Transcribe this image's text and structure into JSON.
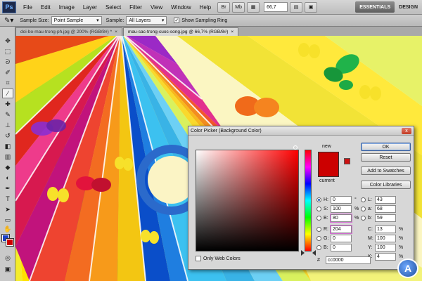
{
  "app": {
    "logo": "Ps",
    "menu": [
      "File",
      "Edit",
      "Image",
      "Layer",
      "Select",
      "Filter",
      "View",
      "Window",
      "Help"
    ],
    "zoom": "66,7",
    "workspace": {
      "active": "ESSENTIALS",
      "other": "DESIGN"
    }
  },
  "options": {
    "sample_size_label": "Sample Size:",
    "sample_size_value": "Point Sample",
    "sample_label": "Sample:",
    "sample_value": "All Layers",
    "show_ring_label": "Show Sampling Ring",
    "show_ring_checked": true
  },
  "tabs": [
    {
      "label": "doi-bo-mau-trong-ph.jpg @ 200% (RGB/8#) *",
      "active": false
    },
    {
      "label": "mau-sac-trong-cuoc-song.jpg @ 66,7% (RGB/8#)",
      "active": true
    }
  ],
  "toolbox": {
    "icons": [
      "move-icon",
      "marquee-icon",
      "lasso-icon",
      "quick-select-icon",
      "crop-icon",
      "eyedropper-icon",
      "healing-icon",
      "brush-icon",
      "stamp-icon",
      "history-brush-icon",
      "eraser-icon",
      "gradient-icon",
      "blur-icon",
      "dodge-icon",
      "pen-icon",
      "type-icon",
      "path-select-icon",
      "shape-icon",
      "hand-icon",
      "zoom-icon"
    ],
    "selected": "eyedropper-icon",
    "foreground_color": "#1d41c7",
    "background_color": "#cc0000"
  },
  "dialog": {
    "title": "Color Picker (Background Color)",
    "close": "x",
    "new_label": "new",
    "current_label": "current",
    "selected_color": "#cc0000",
    "buttons": {
      "ok": "OK",
      "reset": "Reset",
      "add_swatches": "Add to Swatches",
      "libraries": "Color Libraries"
    },
    "only_web_colors": "Only Web Colors",
    "hsb": [
      {
        "label": "H:",
        "value": "0",
        "unit": "°",
        "selected": true
      },
      {
        "label": "S:",
        "value": "100",
        "unit": "%",
        "selected": false
      },
      {
        "label": "B:",
        "value": "80",
        "unit": "%",
        "selected": false
      }
    ],
    "rgb": [
      {
        "label": "R:",
        "value": "204",
        "selected": false
      },
      {
        "label": "G:",
        "value": "0",
        "selected": false
      },
      {
        "label": "B:",
        "value": "0",
        "selected": false
      }
    ],
    "lab": [
      {
        "label": "L:",
        "value": "43"
      },
      {
        "label": "a:",
        "value": "68"
      },
      {
        "label": "b:",
        "value": "59"
      }
    ],
    "cmyk": [
      {
        "label": "C:",
        "value": "13",
        "unit": "%"
      },
      {
        "label": "M:",
        "value": "100",
        "unit": "%"
      },
      {
        "label": "Y:",
        "value": "100",
        "unit": "%"
      },
      {
        "label": "K:",
        "value": "4",
        "unit": "%"
      }
    ],
    "hex_label": "#",
    "hex_value": "cc0000"
  },
  "watermark": "A"
}
